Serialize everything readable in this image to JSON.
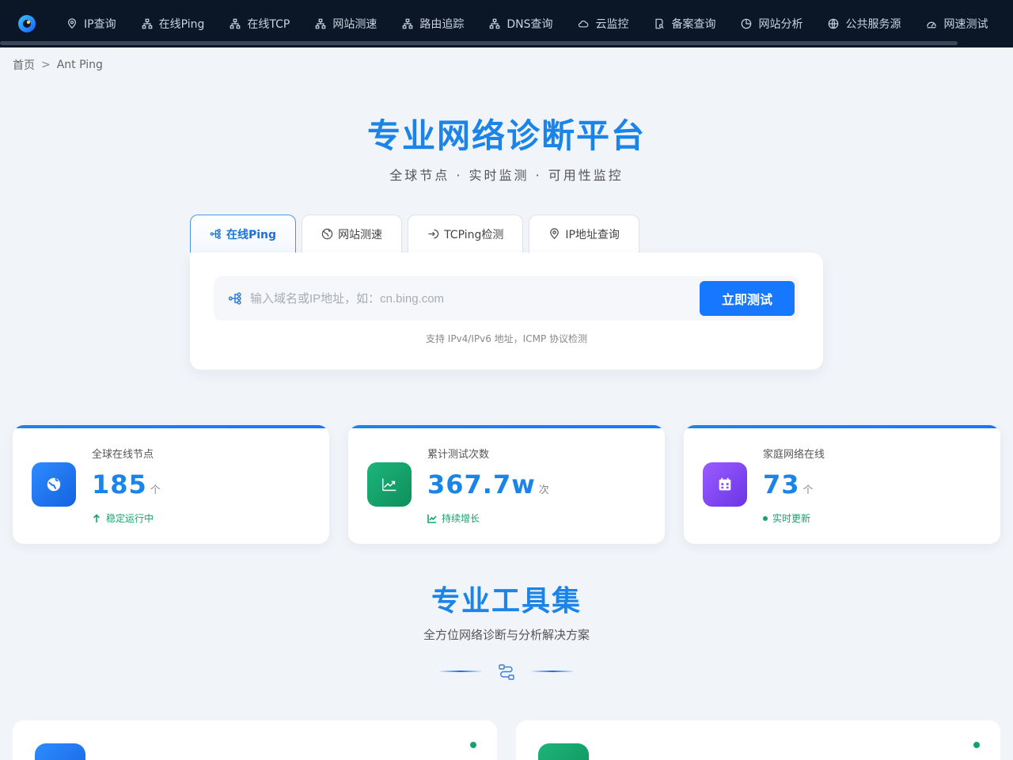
{
  "nav": {
    "items": [
      {
        "label": "IP查询",
        "icon": "map-pin-icon"
      },
      {
        "label": "在线Ping",
        "icon": "network-icon"
      },
      {
        "label": "在线TCP",
        "icon": "network-icon"
      },
      {
        "label": "网站测速",
        "icon": "network-icon"
      },
      {
        "label": "路由追踪",
        "icon": "network-icon"
      },
      {
        "label": "DNS查询",
        "icon": "network-icon"
      },
      {
        "label": "云监控",
        "icon": "cloud-icon"
      },
      {
        "label": "备案查询",
        "icon": "document-search-icon"
      },
      {
        "label": "网站分析",
        "icon": "pie-chart-icon"
      },
      {
        "label": "公共服务源",
        "icon": "globe-icon"
      },
      {
        "label": "网速测试",
        "icon": "gauge-icon"
      }
    ]
  },
  "breadcrumb": {
    "home": "首页",
    "separator": ">",
    "current": "Ant Ping"
  },
  "hero": {
    "title": "专业网络诊断平台",
    "subtitle": "全球节点 · 实时监测 · 可用性监控"
  },
  "tabs": [
    {
      "label": "在线Ping",
      "active": true
    },
    {
      "label": "网站测速",
      "active": false
    },
    {
      "label": "TCPing检测",
      "active": false
    },
    {
      "label": "IP地址查询",
      "active": false
    }
  ],
  "search": {
    "placeholder": "输入域名或IP地址，如：cn.bing.com",
    "value": "",
    "button_label": "立即测试",
    "hint": "支持 IPv4/IPv6 地址，ICMP 协议检测"
  },
  "stats": [
    {
      "label": "全球在线节点",
      "value": "185",
      "unit": "个",
      "foot": "稳定运行中",
      "color": "#1677ff"
    },
    {
      "label": "累计测试次数",
      "value": "367.7w",
      "unit": "次",
      "foot": "持续增长",
      "color": "#13a26b"
    },
    {
      "label": "家庭网络在线",
      "value": "73",
      "unit": "个",
      "foot": "实时更新",
      "color": "#7c4dff"
    }
  ],
  "tools": {
    "title": "专业工具集",
    "subtitle": "全方位网络诊断与分析解决方案"
  },
  "colors": {
    "accent": "#1677ff",
    "nav_bg": "#0b1626",
    "success": "#16a36a"
  }
}
